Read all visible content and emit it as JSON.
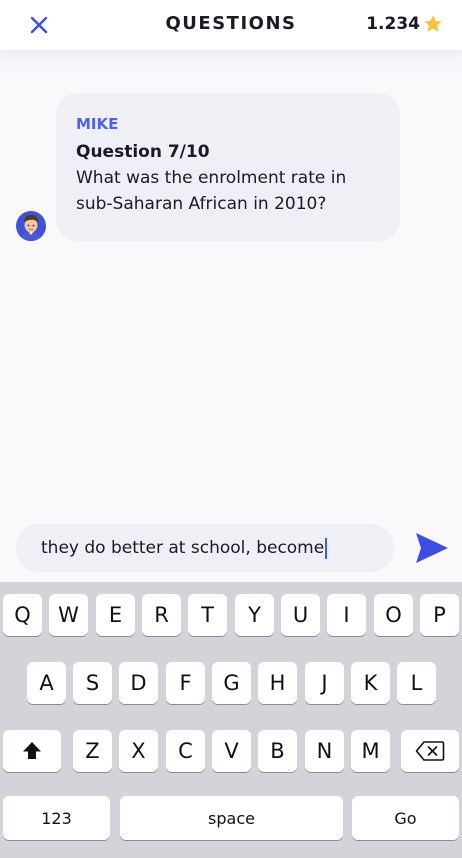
{
  "header": {
    "title": "QUESTIONS",
    "score": "1.234",
    "accent_color": "#3d4ee6",
    "star_color": "#f9c23c"
  },
  "message": {
    "sender": "MIKE",
    "question_number": "Question 7/10",
    "question_line1": "What was the enrolment rate in",
    "question_line2": "sub-Saharan African in 2010?"
  },
  "input": {
    "value": "they do better at school, become"
  },
  "keyboard": {
    "row1": [
      "Q",
      "W",
      "E",
      "R",
      "T",
      "Y",
      "U",
      "I",
      "O",
      "P"
    ],
    "row2": [
      "A",
      "S",
      "D",
      "F",
      "G",
      "H",
      "J",
      "K",
      "L"
    ],
    "row3": [
      "Z",
      "X",
      "C",
      "V",
      "B",
      "N",
      "M"
    ],
    "numbers_label": "123",
    "space_label": "space",
    "go_label": "Go"
  }
}
